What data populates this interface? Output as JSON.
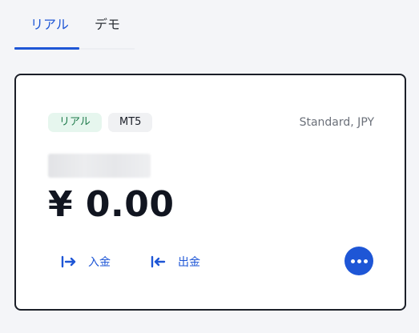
{
  "tabs": {
    "real_label": "リアル",
    "demo_label": "デモ",
    "active": "real"
  },
  "account": {
    "status_badge": "リアル",
    "platform_badge": "MT5",
    "type_currency": "Standard, JPY",
    "balance": "¥ 0.00"
  },
  "actions": {
    "deposit_label": "入金",
    "withdraw_label": "出金",
    "more_icon": "more-horizontal-icon"
  },
  "colors": {
    "accent": "#1e56d6",
    "real_badge_bg": "#e6f6ee",
    "real_badge_text": "#1d7a4a"
  }
}
